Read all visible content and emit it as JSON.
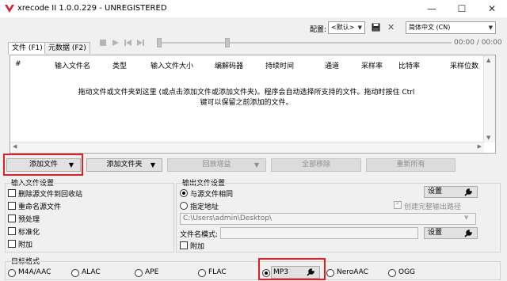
{
  "window": {
    "title": "xrecode II 1.0.0.229 - UNREGISTERED",
    "minimize": "—",
    "maximize": "☐",
    "close": "✕"
  },
  "toolbar": {
    "config_label": "配置:",
    "config_value": "<默认>",
    "language_value": "简体中文 (CN)",
    "player_time": "00:00 / 00:00"
  },
  "tabs": [
    {
      "label": "文件 (F1)"
    },
    {
      "label": "元数据 (F2)"
    }
  ],
  "file_list": {
    "columns": [
      "#",
      "输入文件名",
      "类型",
      "输入文件大小",
      "编解码器",
      "持续时间",
      "通道",
      "采样率",
      "比特率",
      "采样位数"
    ],
    "hint_line1": "拖动文件或文件夹到这里 (或点击添加文件或添加文件夹)。程序会自动选择所支持的文件。拖动时按住 Ctrl",
    "hint_line2": "键可以保留之前添加的文件。"
  },
  "actions": {
    "add_files": "添加文件",
    "add_folder": "添加文件夹",
    "replay_gain": "回放增益",
    "remove_all": "全部移除",
    "rename_all": "重新所有"
  },
  "input_settings": {
    "title": "输入文件设置",
    "options": [
      "删除源文件到回收站",
      "重命名源文件",
      "预处理",
      "标准化",
      "附加"
    ]
  },
  "output_settings": {
    "title": "输出文件设置",
    "same_as_source": "与源文件相同",
    "specified_path": "指定地址",
    "settings_button": "设置",
    "create_full_path": "创建完整输出路径",
    "path_value": "C:\\Users\\admin\\Desktop\\",
    "filename_pattern_label": "文件名模式:",
    "filename_settings_button": "设置",
    "append_label": "附加"
  },
  "target_format": {
    "title": "目标格式",
    "formats": [
      "M4A/AAC",
      "ALAC",
      "APE",
      "FLAC",
      "MP3",
      "NeroAAC",
      "OGG"
    ],
    "selected": "MP3"
  }
}
